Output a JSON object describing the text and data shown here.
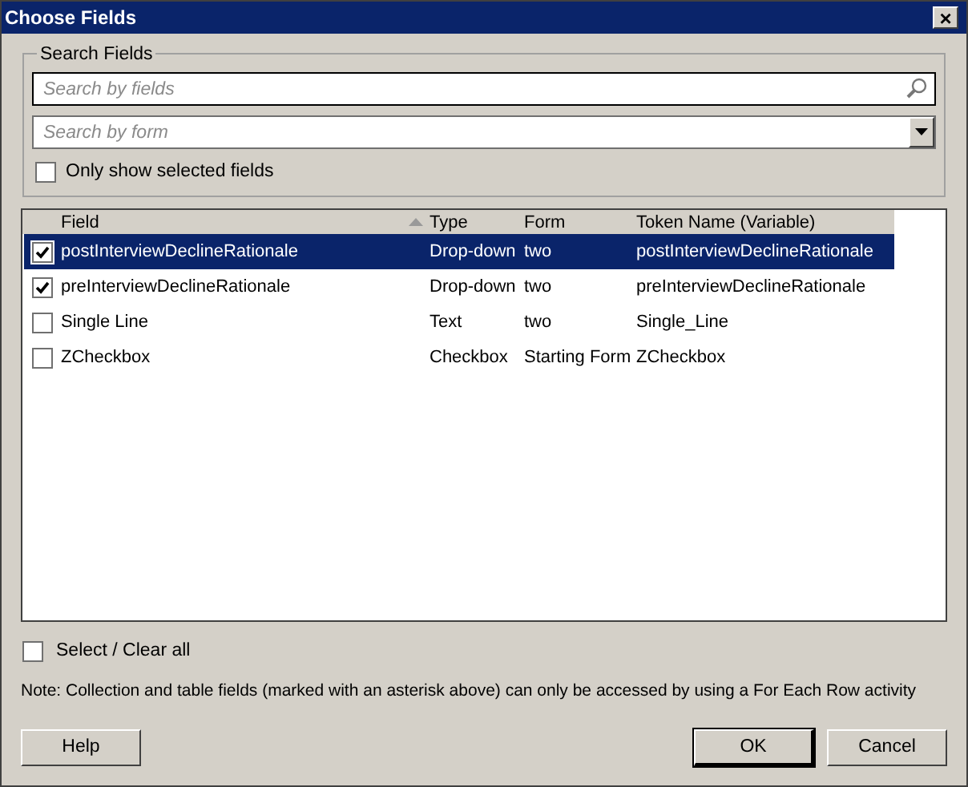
{
  "window": {
    "title": "Choose Fields",
    "close": "×"
  },
  "search_group": {
    "title": "Search Fields",
    "search_field": {
      "placeholder": "Search by fields"
    },
    "form_combo": {
      "placeholder": "Search by form"
    },
    "only_selected": {
      "label": "Only show selected fields",
      "checked": false
    }
  },
  "table": {
    "columns": [
      {
        "label": "Field",
        "sorted": true
      },
      {
        "label": "Type",
        "sorted": false
      },
      {
        "label": "Form",
        "sorted": false
      },
      {
        "label": "Token Name (Variable)",
        "sorted": false
      }
    ],
    "rows": [
      {
        "checked": true,
        "selected": true,
        "cells": [
          "postInterviewDeclineRationale",
          "Drop-down",
          "two",
          "postInterviewDeclineRationale"
        ]
      },
      {
        "checked": true,
        "selected": false,
        "cells": [
          "preInterviewDeclineRationale",
          "Drop-down",
          "two",
          "preInterviewDeclineRationale"
        ]
      },
      {
        "checked": false,
        "selected": false,
        "cells": [
          "Single Line",
          "Text",
          "two",
          "Single_Line"
        ]
      },
      {
        "checked": false,
        "selected": false,
        "cells": [
          "ZCheckbox",
          "Checkbox",
          "Starting Form",
          "ZCheckbox"
        ]
      }
    ]
  },
  "select_all": {
    "label": "Select / Clear all",
    "checked": false
  },
  "note": "Note: Collection and table fields (marked with an asterisk above) can only be accessed by using a For Each Row activity",
  "buttons": [
    {
      "label": "Help",
      "default": false
    },
    {
      "label": "OK",
      "default": true
    },
    {
      "label": "Cancel",
      "default": false
    }
  ]
}
